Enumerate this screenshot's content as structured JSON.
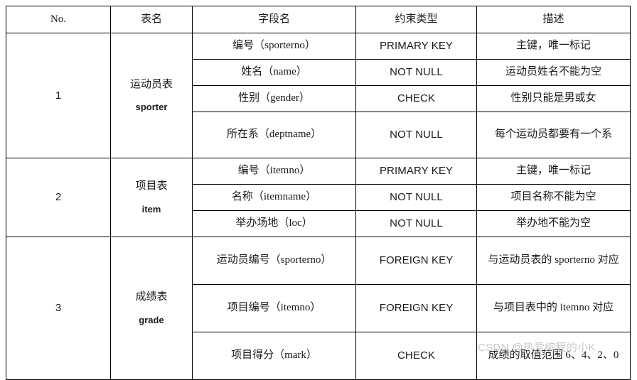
{
  "table": {
    "columns": [
      {
        "key": "no",
        "label": "No."
      },
      {
        "key": "tname",
        "label": "表名"
      },
      {
        "key": "field",
        "label": "字段名"
      },
      {
        "key": "ctype",
        "label": "约束类型"
      },
      {
        "key": "desc",
        "label": "描述"
      }
    ],
    "groups": [
      {
        "no": "1",
        "table_cn": "运动员表",
        "table_en": "sporter",
        "rows": [
          {
            "field": "编号（sporterno）",
            "ctype": "PRIMARY KEY",
            "desc": "主键，唯一标记"
          },
          {
            "field": "姓名（name）",
            "ctype": "NOT NULL",
            "desc": "运动员姓名不能为空"
          },
          {
            "field": "性别（gender）",
            "ctype": "CHECK",
            "desc": "性别只能是男或女"
          },
          {
            "field": "所在系（deptname）",
            "ctype": "NOT NULL",
            "desc": "每个运动员都要有一个系"
          }
        ]
      },
      {
        "no": "2",
        "table_cn": "项目表",
        "table_en": "item",
        "rows": [
          {
            "field": "编号（itemno）",
            "ctype": "PRIMARY KEY",
            "desc": "主键，唯一标记"
          },
          {
            "field": "名称（itemname）",
            "ctype": "NOT NULL",
            "desc": "项目名称不能为空"
          },
          {
            "field": "举办场地（loc）",
            "ctype": "NOT NULL",
            "desc": "举办地不能为空"
          }
        ]
      },
      {
        "no": "3",
        "table_cn": "成绩表",
        "table_en": "grade",
        "rows": [
          {
            "field": "运动员编号（sporterno）",
            "ctype": "FOREIGN KEY",
            "desc": "与运动员表的 sporterno 对应"
          },
          {
            "field": "项目编号（itemno）",
            "ctype": "FOREIGN KEY",
            "desc": "与项目表中的 itemno 对应"
          },
          {
            "field": "项目得分（mark）",
            "ctype": "CHECK",
            "desc": "成绩的取值范围 6、4、2、0"
          }
        ]
      }
    ]
  },
  "watermark": {
    "text": "CSDN @热爱编程的小K",
    "color": "#c9c9c9"
  }
}
